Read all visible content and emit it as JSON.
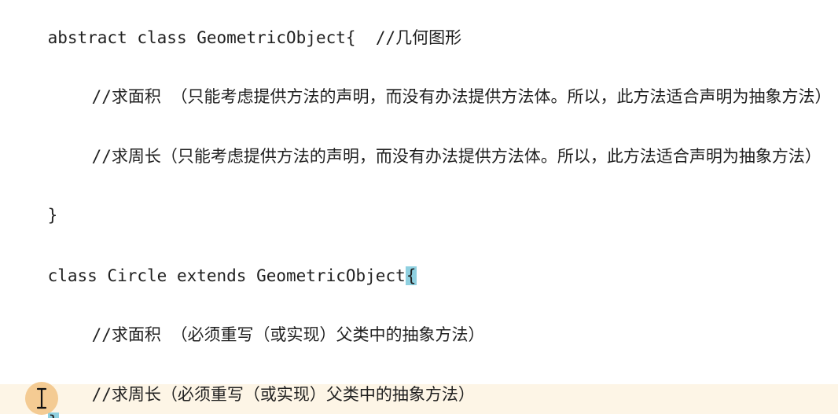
{
  "code": {
    "line1_code": "abstract class GeometricObject{  ",
    "line1_comment": "//几何图形",
    "line2": "//求面积 （只能考虑提供方法的声明，而没有办法提供方法体。所以，此方法适合声明为抽象方法）",
    "line3": "//求周长（只能考虑提供方法的声明，而没有办法提供方法体。所以，此方法适合声明为抽象方法）",
    "line4": "}",
    "line5_code": "class Circle extends GeometricObject",
    "line5_brace": "{",
    "line6": "//求面积 （必须重写（或实现）父类中的抽象方法）",
    "line7": "//求周长（必须重写（或实现）父类中的抽象方法）",
    "line8_brace": "}"
  },
  "colors": {
    "brace_highlight": "#8fd0e0",
    "current_line": "#fdf5e6",
    "cursor_circle": "#f3c78a"
  },
  "icons": {
    "cursor": "text-cursor-icon"
  }
}
